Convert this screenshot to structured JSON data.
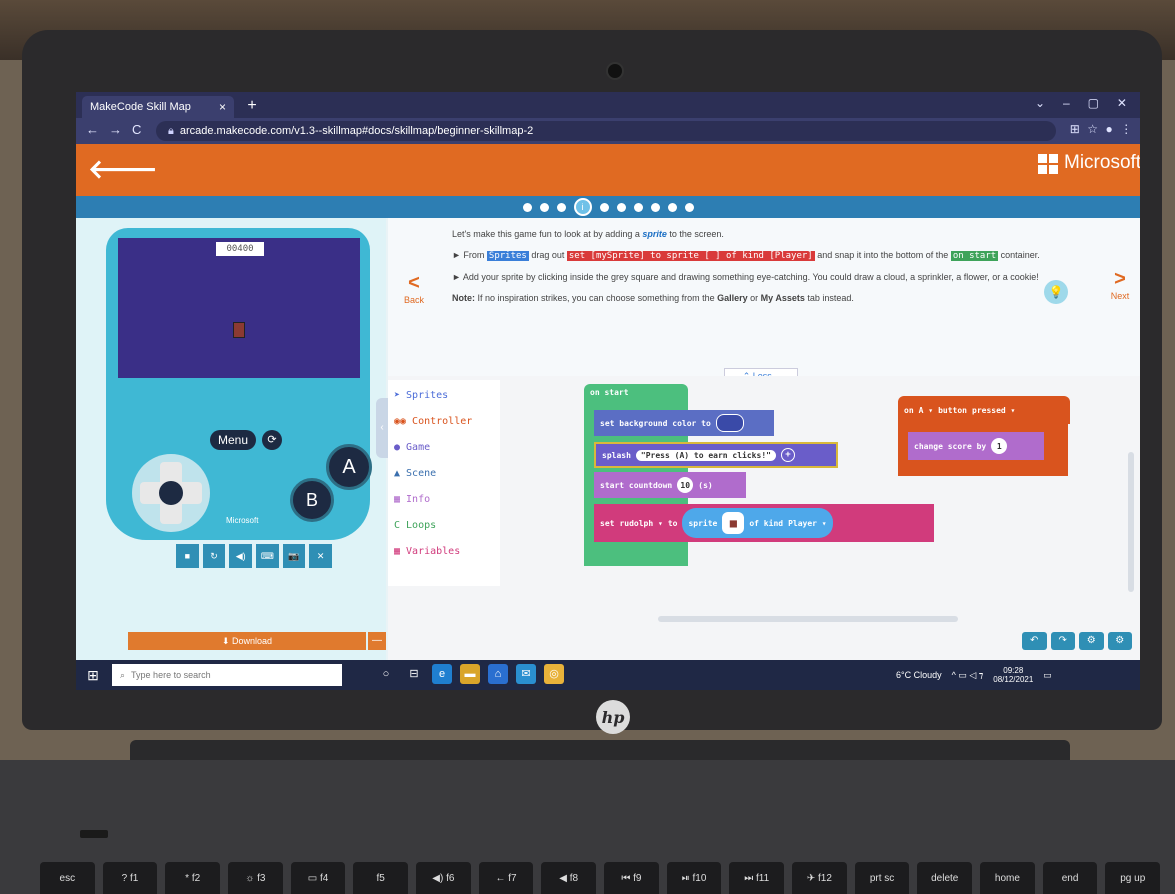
{
  "browser": {
    "tab_title": "MakeCode Skill Map",
    "tab_close": "×",
    "new_tab": "+",
    "url": "arcade.makecode.com/v1.3--skillmap#docs/skillmap/beginner-skillmap-2",
    "window_controls": [
      "⌄",
      "–",
      "▢",
      "✕"
    ],
    "nav": [
      "←",
      "→",
      "C"
    ],
    "toolbar_icons": [
      "⊞",
      "☆",
      "●",
      "⋮"
    ]
  },
  "header": {
    "back": "🡐",
    "brand": "Microsoft"
  },
  "progress": {
    "total": 10,
    "current_index": 3,
    "current_label": "i"
  },
  "simulator": {
    "score": "00400",
    "menu_label": "Menu",
    "reset_icon": "⟳",
    "button_a": "A",
    "button_b": "B",
    "brand": "Microsoft",
    "tools": [
      "■",
      "↻",
      "◀)",
      "⌨",
      "📷",
      "✕"
    ],
    "download_label": "⬇ Download",
    "download_more": "—"
  },
  "instructions": {
    "intro_pre": "Let's make this game fun to look at by adding a ",
    "intro_word": "sprite",
    "intro_post": " to the screen.",
    "step1_pre": "► From ",
    "step1_category": "Sprites",
    "step1_mid": " drag out ",
    "step1_block": "set [mySprite] to sprite [ ] of kind [Player]",
    "step1_post": " and snap it into the bottom of the ",
    "step1_container": "on start",
    "step1_end": " container.",
    "step2": "► Add your sprite by clicking inside the grey square and drawing something eye-catching. You could draw a cloud, a sprinkler, a flower, or a cookie!",
    "note_label": "Note:",
    "note_pre": " If no inspiration strikes, you can choose something from the ",
    "note_gallery": "Gallery",
    "note_mid": " or ",
    "note_assets": "My Assets",
    "note_post": " tab instead.",
    "back_label": "Back",
    "next_label": "Next",
    "back_arrow": "<",
    "next_arrow": ">",
    "less_label": "⌃ Less...",
    "hint_icon": "💡"
  },
  "toolbox": [
    {
      "label": "Sprites",
      "icon": "➤",
      "color": "#4b6cd8"
    },
    {
      "label": "Controller",
      "icon": "◉◉",
      "color": "#d9541e"
    },
    {
      "label": "Game",
      "icon": "●",
      "color": "#6a5dc9"
    },
    {
      "label": "Scene",
      "icon": "▲",
      "color": "#3a6fae"
    },
    {
      "label": "Info",
      "icon": "▦",
      "color": "#b06ccc"
    },
    {
      "label": "Loops",
      "icon": "C",
      "color": "#3ea35a"
    },
    {
      "label": "Variables",
      "icon": "▦",
      "color": "#d13b7c"
    }
  ],
  "blocks": {
    "on_start": "on start",
    "set_bg": "set background color to",
    "splash": "splash",
    "splash_text": "\"Press (A) to earn clicks!\"",
    "splash_plus": "+",
    "countdown": "start countdown",
    "countdown_value": "10",
    "countdown_unit": "(s)",
    "set": "set",
    "variable": "rudolph ▾",
    "to": "to",
    "sprite": "sprite",
    "of_kind": "of kind",
    "kind": "Player ▾",
    "on_a": "on",
    "a_key": "A ▾",
    "button": "button",
    "pressed": "pressed ▾",
    "change_score": "change score by",
    "change_value": "1",
    "collapse": "‹"
  },
  "editor_tools": [
    "↶",
    "↷",
    "⚙",
    "⚙"
  ],
  "taskbar": {
    "start_icon": "⊞",
    "search_placeholder": "Type here to search",
    "search_icon": "⌕",
    "apps": [
      "○",
      "⊟",
      "e",
      "▬",
      "⌂",
      "✉",
      "◎"
    ],
    "weather": "6°C Cloudy",
    "tray_icons": "^ ▭ ◁ ⁊",
    "time": "09:28",
    "date": "08/12/2021",
    "notify_icon": "▭"
  },
  "keyboard": [
    "esc",
    "? f1",
    "* f2",
    "☼ f3",
    "▭ f4",
    "f5",
    "◀) f6",
    "← f7",
    "◀ f8",
    "⏮ f9",
    "⏯ f10",
    "⏭ f11",
    "✈ f12",
    "prt sc",
    "delete",
    "home",
    "end",
    "pg up"
  ],
  "laptop": {
    "logo": "hp"
  },
  "colors": {
    "orange": "#e06a22",
    "progress_blue": "#2d7eb3",
    "console": "#3fb8d4",
    "game_screen": "#3a2f87",
    "on_start_green": "#4cbf7e",
    "event_orange": "#d9541e"
  }
}
